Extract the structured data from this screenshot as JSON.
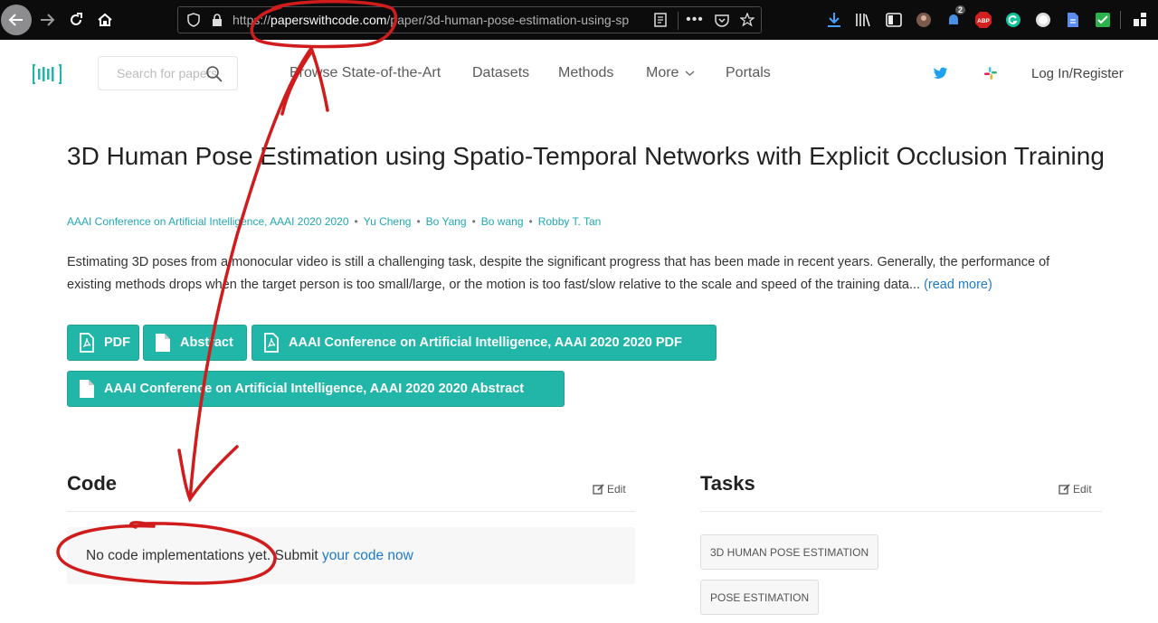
{
  "browser": {
    "url_scheme": "https://",
    "url_host": "paperswithcode.com",
    "url_path": "/paper/3d-human-pose-estimation-using-sp",
    "notification_count": "2",
    "abp_label": "ABP"
  },
  "header": {
    "search_placeholder": "Search for papers",
    "nav": [
      "Browse State-of-the-Art",
      "Datasets",
      "Methods",
      "More",
      "Portals"
    ],
    "login": "Log In/Register"
  },
  "paper": {
    "title": "3D Human Pose Estimation using Spatio-Temporal Networks with Explicit Occlusion Training",
    "conference": "AAAI Conference on Artificial Intelligence, AAAI 2020 2020",
    "authors": [
      "Yu Cheng",
      "Bo Yang",
      "Bo wang",
      "Robby T. Tan"
    ],
    "abstract": "Estimating 3D poses from a monocular video is still a challenging task, despite the significant progress that has been made in recent years. Generally, the performance of existing methods drops when the target person is too small/large, or the motion is too fast/slow relative to the scale and speed of the training data...",
    "read_more": "(read more)",
    "buttons": {
      "pdf": "PDF",
      "abstract": "Abstract",
      "conf_pdf": "AAAI Conference on Artificial Intelligence, AAAI 2020 2020 PDF",
      "conf_abstract": "AAAI Conference on Artificial Intelligence, AAAI 2020 2020 Abstract"
    }
  },
  "code_section": {
    "title": "Code",
    "edit": "Edit",
    "empty_text": "No code implementations yet. Submit ",
    "submit_link": "your code now"
  },
  "tasks_section": {
    "title": "Tasks",
    "edit": "Edit",
    "tasks": [
      "3D HUMAN POSE ESTIMATION",
      "POSE ESTIMATION"
    ]
  },
  "colors": {
    "accent": "#21b6a8",
    "link": "#1f7bc9",
    "annotation": "#d01c1c"
  }
}
